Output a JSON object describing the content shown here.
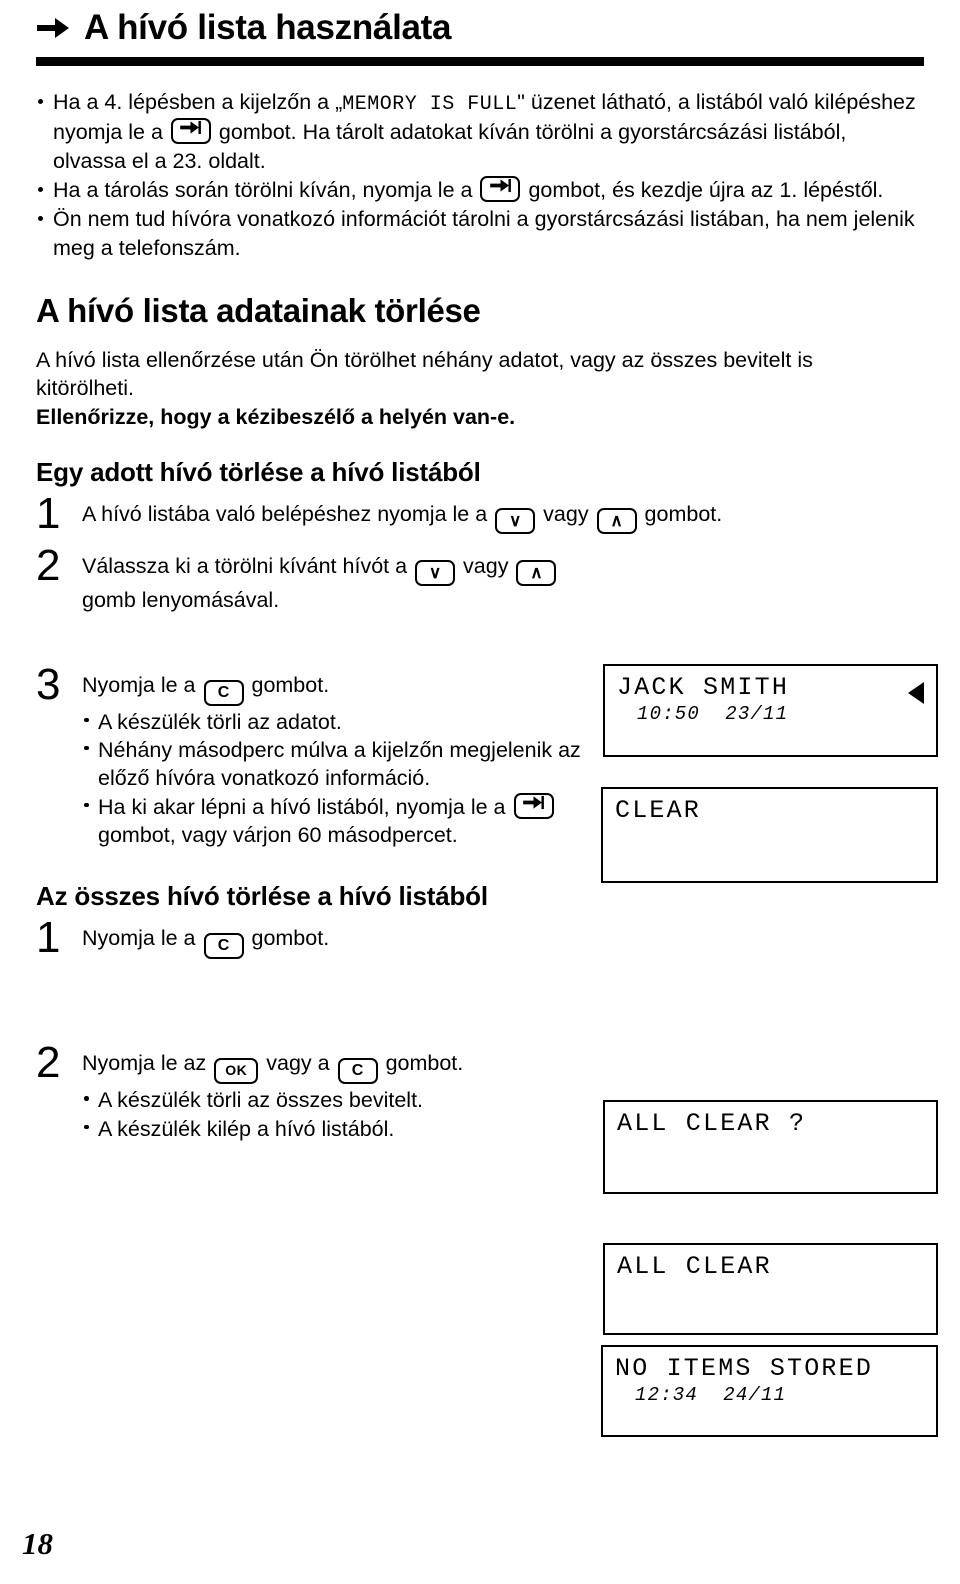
{
  "header": {
    "arrow_icon": "right-arrow-icon",
    "title": "A hívó lista használata"
  },
  "intro_notes": [
    {
      "parts": [
        "Ha a 4. lépésben a kijelzőn a „",
        "MEMORY IS FULL",
        "\" üzenet látható, a listából való kilépéshez nyomja le a ",
        "exit-key",
        " gombot. Ha tárolt adatokat kíván törölni a gyorstárcsázási listából, olvassa el a 23. oldalt."
      ]
    },
    {
      "parts": [
        "Ha a tárolás során törölni kíván, nyomja le a ",
        "exit-key",
        " gombot, és kezdje újra az 1. lépéstől."
      ]
    },
    {
      "text": "Ön nem tud hívóra vonatkozó információt tárolni a gyorstárcsázási listában, ha nem jelenik meg a telefonszám."
    }
  ],
  "note1": {
    "a": "Ha a 4. lépésben a kijelzőn a „",
    "mono": "MEMORY IS FULL",
    "b": "\" üzenet látható, a listából való",
    "c": "kilépéshez nyomja le a",
    "d": "gombot. Ha tárolt adatokat kíván törölni a",
    "e": "gyorstárcsázási listából, olvassa el a 23. oldalt."
  },
  "note2": {
    "a": "Ha a tárolás során törölni kíván, nyomja le a",
    "b": "gombot, és kezdje újra az 1.",
    "c": "lépéstől."
  },
  "note3": {
    "text": "Ön nem tud hívóra vonatkozó információt tárolni a gyorstárcsázási listában, ha nem jelenik meg a telefonszám."
  },
  "section_delete": {
    "heading": "A hívó lista adatainak törlése",
    "paragraph": "A hívó lista ellenőrzése után Ön törölhet néhány adatot, vagy az összes bevitelt is kitörölheti.",
    "bold_line": "Ellenőrizze, hogy a kézibeszélő a helyén van-e."
  },
  "subsection_single": {
    "heading": "Egy adott hívó törlése a hívó listából",
    "steps": [
      {
        "number": "1",
        "text_a": "A hívó listába való belépéshez nyomja le a",
        "key1": "down-key",
        "text_b": "vagy",
        "key2": "up-key",
        "text_c": "gombot."
      },
      {
        "number": "2",
        "text_a": "Válassza ki a törölni kívánt hívót a",
        "key1": "down-key",
        "text_b": "vagy",
        "key2": "up-key",
        "text_c": "gomb lenyomásával."
      },
      {
        "number": "3",
        "text_a": "Nyomja le a",
        "key1": "clear-key",
        "text_c": "gombot.",
        "bullets": [
          "A készülék törli az adatot.",
          "Néhány másodperc múlva a kijelzőn megjelenik az előző hívóra vonatkozó információ."
        ],
        "bullet3_a": "Ha ki akar lépni a hívó listából, nyomja le a",
        "bullet3_key": "exit-key",
        "bullet3_b": "gombot, vagy várjon 60 másodpercet."
      }
    ]
  },
  "subsection_all": {
    "heading": "Az összes hívó törlése a hívó listából",
    "steps": [
      {
        "number": "1",
        "text_a": "Nyomja le a",
        "key1": "clear-key",
        "text_c": "gombot."
      },
      {
        "number": "2",
        "text_a": "Nyomja le az",
        "key1": "ok-key",
        "text_b": "vagy a",
        "key2": "clear-key",
        "text_c": "gombot.",
        "bullets": [
          "A készülék törli az összes bevitelt.",
          "A készülék kilép a hívó listából."
        ]
      }
    ]
  },
  "keys": {
    "exit_label": "exit-arrow-icon",
    "down_label": "∨",
    "up_label": "∧",
    "clear_label": "C",
    "ok_label": "OK"
  },
  "lcd_displays": [
    {
      "id": "jack-smith",
      "line1": "JACK SMITH",
      "line2": "10:50  23/11",
      "caret": true
    },
    {
      "id": "clear",
      "line1": "CLEAR",
      "line2": "",
      "caret": false
    },
    {
      "id": "all-clear-q",
      "line1": "ALL CLEAR ?",
      "line2": "",
      "caret": false
    },
    {
      "id": "all-clear",
      "line1": "ALL CLEAR",
      "line2": "",
      "caret": false
    },
    {
      "id": "no-items",
      "line1": "NO ITEMS STORED",
      "line2": "12:34  24/11",
      "caret": false
    }
  ],
  "footer": {
    "page_number": "18"
  },
  "colors": {
    "ink": "#000000",
    "paper": "#ffffff"
  }
}
